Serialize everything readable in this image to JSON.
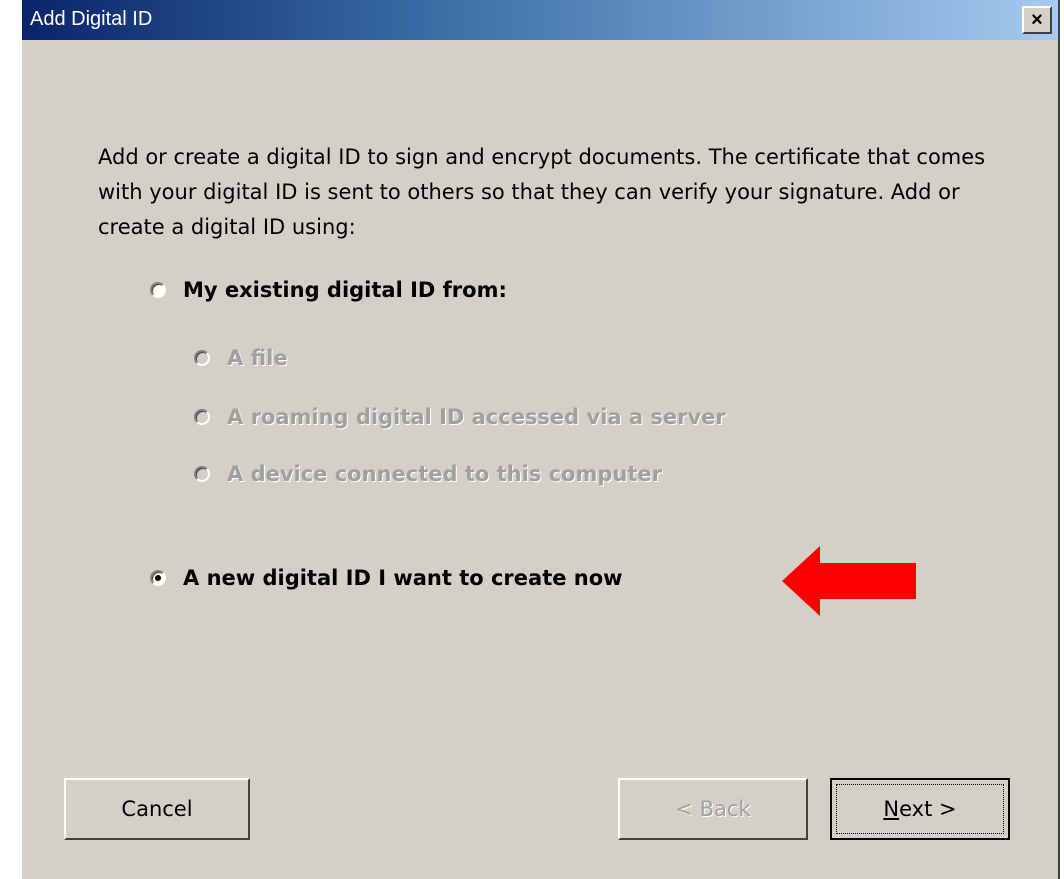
{
  "window": {
    "title": "Add Digital ID",
    "close_label": "×"
  },
  "intro_text": "Add or create a digital ID to sign and encrypt documents. The certificate that comes with your digital ID is sent to others so that they can verify your signature. Add or create a digital ID using:",
  "options": {
    "existing": {
      "label": "My existing digital ID from:",
      "selected": false,
      "sub_options": [
        {
          "label": "A file",
          "enabled": false
        },
        {
          "label": "A roaming digital ID accessed via a server",
          "enabled": false
        },
        {
          "label": "A device connected to this computer",
          "enabled": false
        }
      ]
    },
    "new": {
      "label": "A new digital ID I want to create now",
      "selected": true
    }
  },
  "annotation": {
    "arrow_color": "#ff0000",
    "arrow_icon": "left-arrow-icon"
  },
  "buttons": {
    "cancel": "Cancel",
    "back": "< Back",
    "next": "Next >"
  },
  "colors": {
    "dialog_bg": "#d4d0c8",
    "title_gradient_start": "#0a246a",
    "title_gradient_end": "#a6caf0",
    "disabled_text": "#a0a0a0"
  }
}
